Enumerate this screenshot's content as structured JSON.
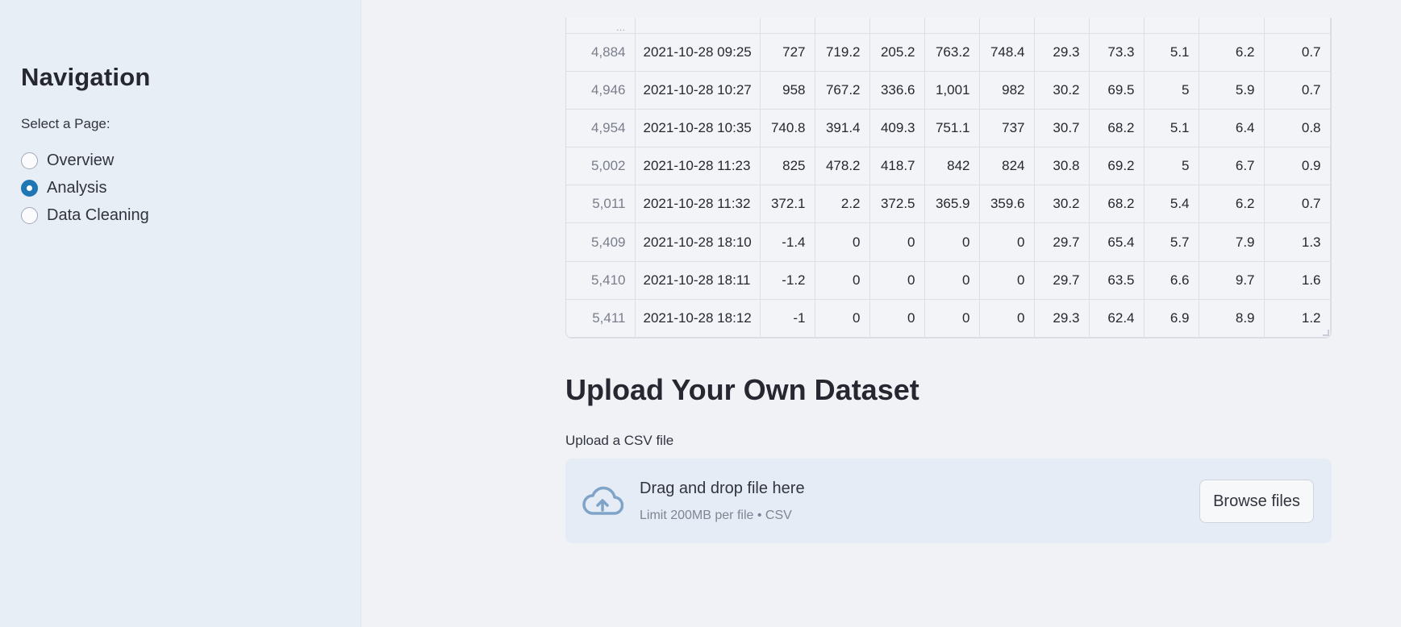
{
  "sidebar": {
    "title": "Navigation",
    "select_label": "Select a Page:",
    "options": [
      "Overview",
      "Analysis",
      "Data Cleaning"
    ],
    "selected": "Analysis"
  },
  "table": {
    "partial_row_index": "…",
    "rows": [
      [
        "4,884",
        "2021-10-28 09:25",
        "727",
        "719.2",
        "205.2",
        "763.2",
        "748.4",
        "29.3",
        "73.3",
        "5.1",
        "6.2",
        "0.7"
      ],
      [
        "4,946",
        "2021-10-28 10:27",
        "958",
        "767.2",
        "336.6",
        "1,001",
        "982",
        "30.2",
        "69.5",
        "5",
        "5.9",
        "0.7"
      ],
      [
        "4,954",
        "2021-10-28 10:35",
        "740.8",
        "391.4",
        "409.3",
        "751.1",
        "737",
        "30.7",
        "68.2",
        "5.1",
        "6.4",
        "0.8"
      ],
      [
        "5,002",
        "2021-10-28 11:23",
        "825",
        "478.2",
        "418.7",
        "842",
        "824",
        "30.8",
        "69.2",
        "5",
        "6.7",
        "0.9"
      ],
      [
        "5,011",
        "2021-10-28 11:32",
        "372.1",
        "2.2",
        "372.5",
        "365.9",
        "359.6",
        "30.2",
        "68.2",
        "5.4",
        "6.2",
        "0.7"
      ],
      [
        "5,409",
        "2021-10-28 18:10",
        "-1.4",
        "0",
        "0",
        "0",
        "0",
        "29.7",
        "65.4",
        "5.7",
        "7.9",
        "1.3"
      ],
      [
        "5,410",
        "2021-10-28 18:11",
        "-1.2",
        "0",
        "0",
        "0",
        "0",
        "29.7",
        "63.5",
        "6.6",
        "9.7",
        "1.6"
      ],
      [
        "5,411",
        "2021-10-28 18:12",
        "-1",
        "0",
        "0",
        "0",
        "0",
        "29.3",
        "62.4",
        "6.9",
        "8.9",
        "1.2"
      ]
    ]
  },
  "upload": {
    "title": "Upload Your Own Dataset",
    "label": "Upload a CSV file",
    "drop_text": "Drag and drop file here",
    "limit_text": "Limit 200MB per file • CSV",
    "browse_label": "Browse files",
    "icon": "cloud-upload-icon",
    "icon_color": "#7fa3c9"
  },
  "colors": {
    "accent": "#1f77b4",
    "sidebar_bg": "#e8eef6",
    "main_bg": "#f0f2f6"
  }
}
